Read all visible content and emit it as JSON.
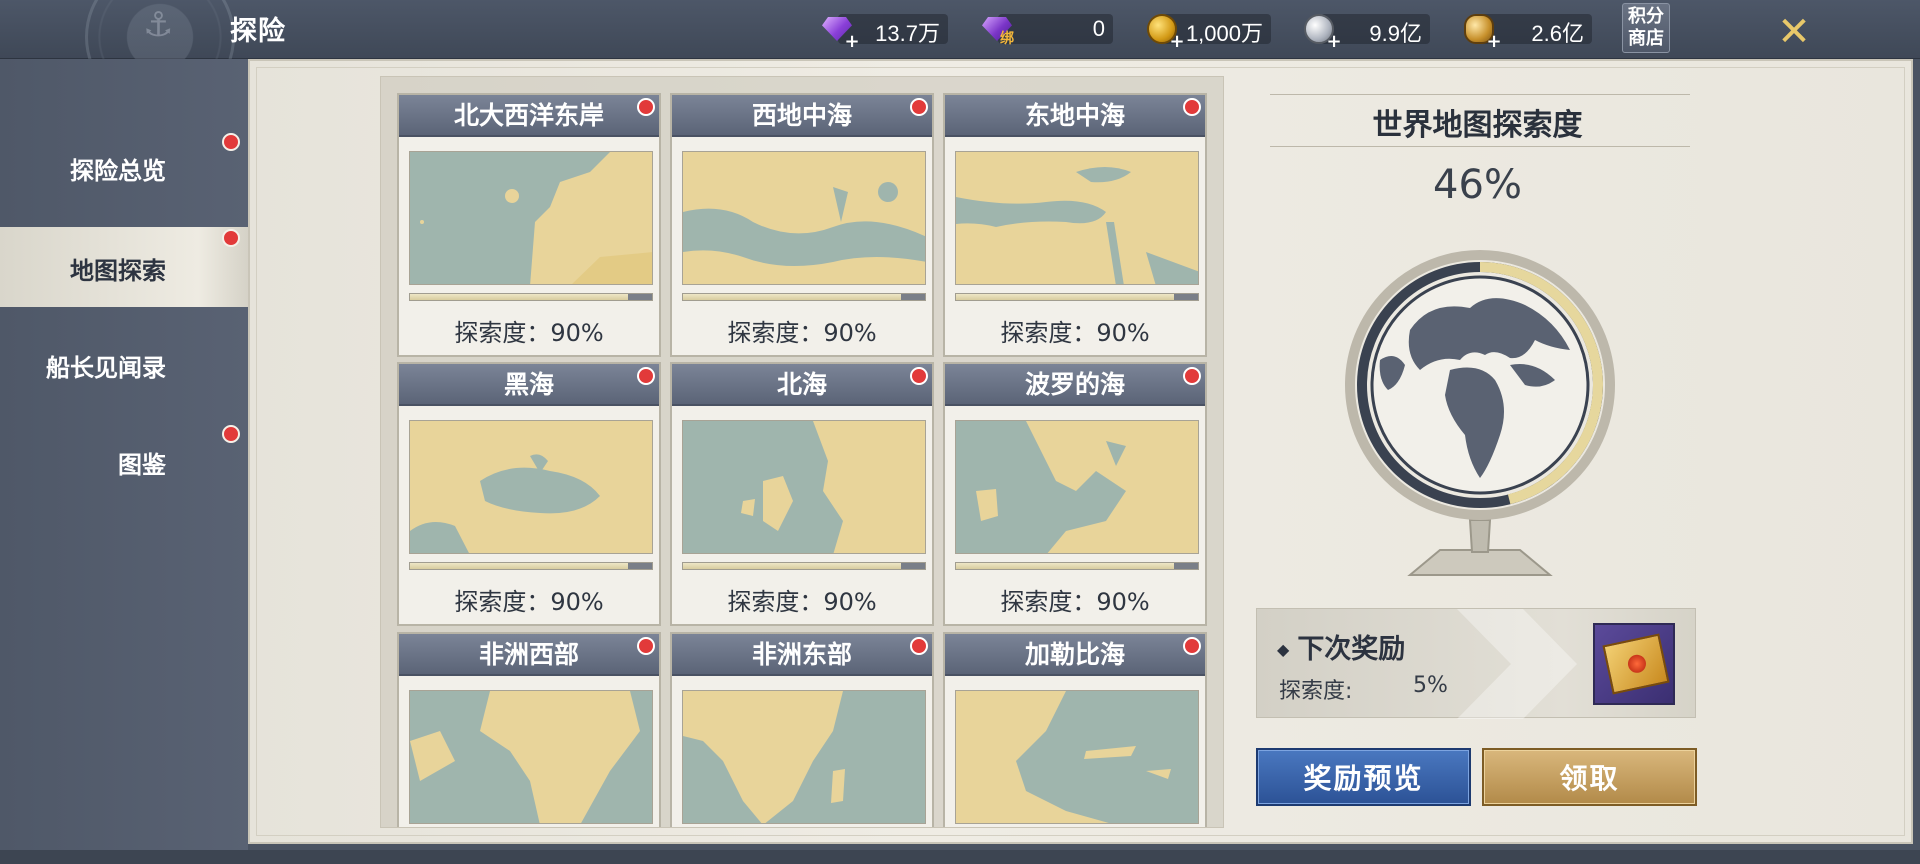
{
  "header": {
    "title": "探险",
    "currencies": [
      {
        "icon": "purple-gem-icon",
        "value": "13.7万"
      },
      {
        "icon": "bound-purple-gem-icon",
        "tag": "绑",
        "value": "0"
      },
      {
        "icon": "gold-coin-icon",
        "value": "1,000万"
      },
      {
        "icon": "silver-coin-icon",
        "value": "9.9亿"
      },
      {
        "icon": "copper-coin-icon",
        "value": "2.6亿"
      }
    ],
    "shop_button": "积分\n商店",
    "shop_line1": "积分",
    "shop_line2": "商店",
    "close_icon": "close-x-icon"
  },
  "sidebar": {
    "items": [
      {
        "label": "探险总览",
        "badge": true,
        "active": false
      },
      {
        "label": "地图探索",
        "badge": true,
        "active": true
      },
      {
        "label": "船长见闻录",
        "badge": false,
        "active": false
      },
      {
        "label": "图鉴",
        "badge": true,
        "active": false
      }
    ]
  },
  "regions": [
    {
      "name": "北大西洋东岸",
      "progress_label": "探索度：90%",
      "progress": 0.9,
      "badge": true
    },
    {
      "name": "西地中海",
      "progress_label": "探索度：90%",
      "progress": 0.9,
      "badge": true
    },
    {
      "name": "东地中海",
      "progress_label": "探索度：90%",
      "progress": 0.9,
      "badge": true
    },
    {
      "name": "黑海",
      "progress_label": "探索度：90%",
      "progress": 0.9,
      "badge": true
    },
    {
      "name": "北海",
      "progress_label": "探索度：90%",
      "progress": 0.9,
      "badge": true
    },
    {
      "name": "波罗的海",
      "progress_label": "探索度：90%",
      "progress": 0.9,
      "badge": true
    },
    {
      "name": "非洲西部",
      "progress_label": "",
      "progress": null,
      "badge": true
    },
    {
      "name": "非洲东部",
      "progress_label": "",
      "progress": null,
      "badge": true
    },
    {
      "name": "加勒比海",
      "progress_label": "",
      "progress": null,
      "badge": true
    }
  ],
  "world": {
    "title": "世界地图探索度",
    "percent_label": "46%",
    "percent": 0.46
  },
  "reward": {
    "title": "下次奖励",
    "progress_label": "探索度:",
    "progress_value": "5%",
    "item_icon": "sealed-envelope-icon"
  },
  "buttons": {
    "preview": "奖励预览",
    "claim": "领取"
  },
  "colors": {
    "accent_blue": "#2c5296",
    "accent_gold": "#b28a49",
    "badge_red": "#e23a3a",
    "header_bg": "#4d5768",
    "sea": "#9fb5ad",
    "land": "#e8d49a"
  }
}
